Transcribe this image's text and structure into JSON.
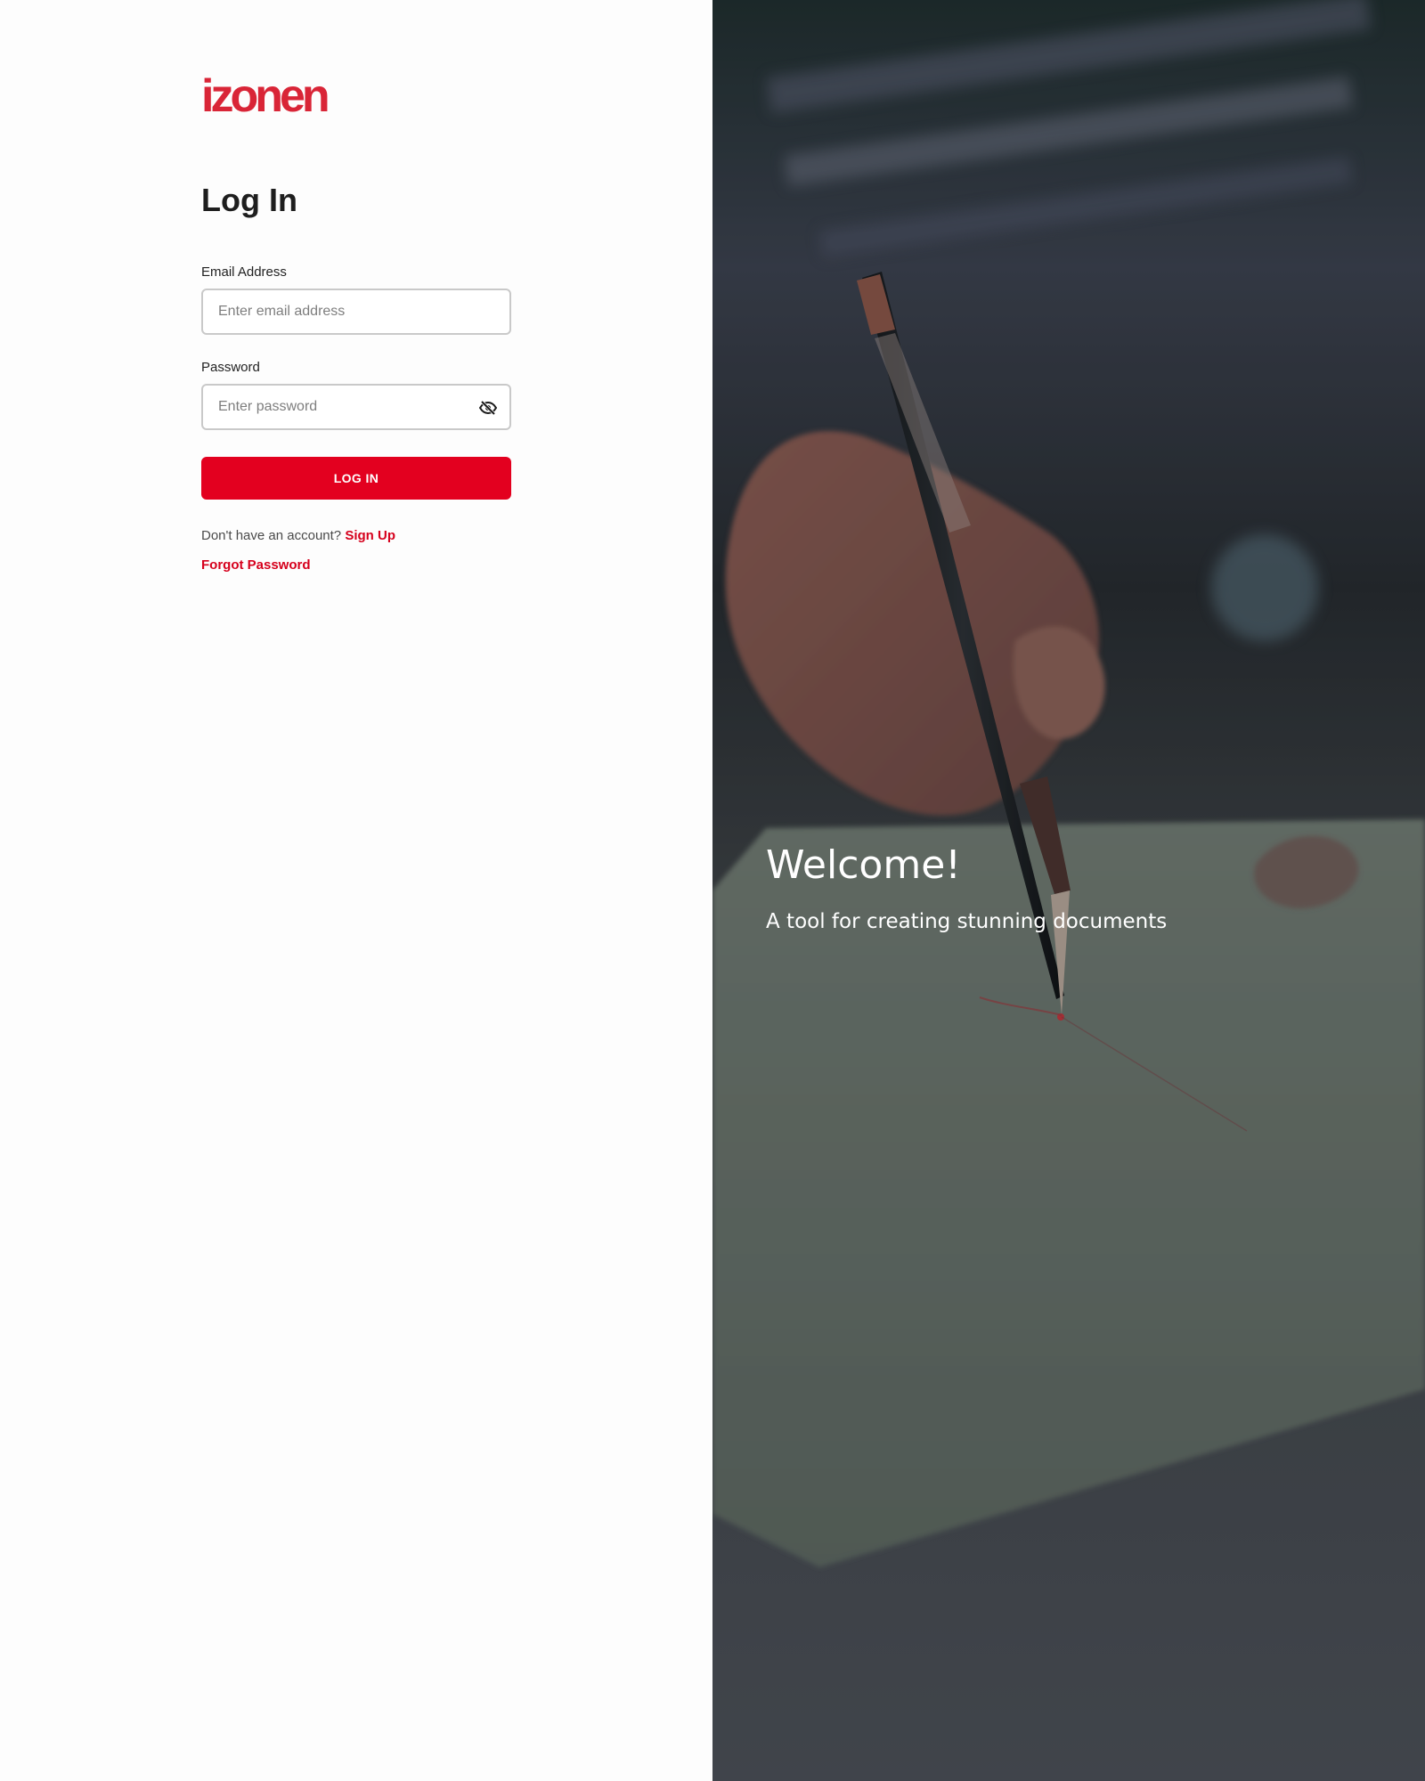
{
  "brand": {
    "logo_text": "izonen",
    "accent_color": "#e3001f"
  },
  "login_form": {
    "title": "Log In",
    "email": {
      "label": "Email Address",
      "placeholder": "Enter email address",
      "value": ""
    },
    "password": {
      "label": "Password",
      "placeholder": "Enter password",
      "value": "",
      "visibility_icon": "eye-slash-icon"
    },
    "submit_label": "LOG IN",
    "signup_prompt": "Don't have an account?",
    "signup_link": "Sign Up",
    "forgot_password_link": "Forgot Password"
  },
  "hero": {
    "title": "Welcome!",
    "subtitle": "A tool for creating stunning documents"
  }
}
